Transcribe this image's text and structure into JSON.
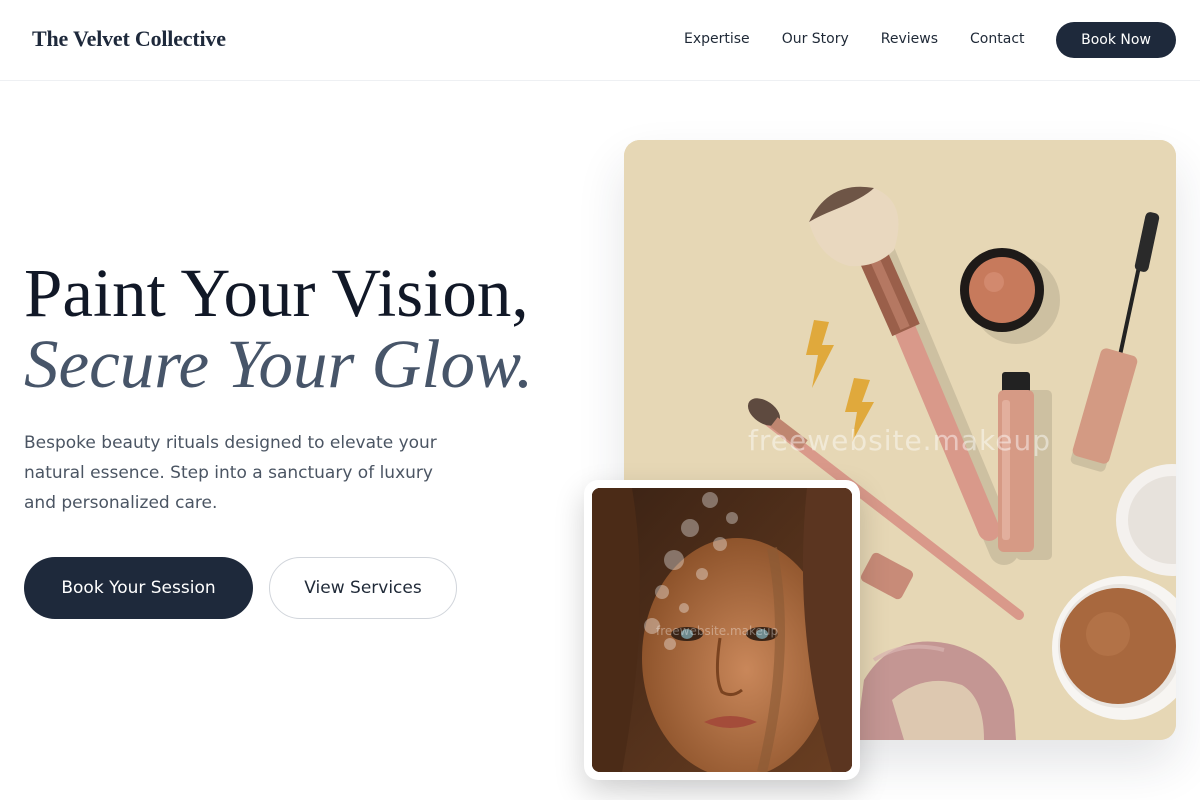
{
  "header": {
    "brand": "The Velvet Collective",
    "nav": [
      "Expertise",
      "Our Story",
      "Reviews",
      "Contact"
    ],
    "cta_label": "Book Now"
  },
  "hero": {
    "headline_line1": "Paint Your Vision,",
    "headline_line2": "Secure Your Glow.",
    "description": "Bespoke beauty rituals designed to elevate your natural essence. Step into a sanctuary of luxury and personalized care.",
    "primary_button": "Book Your Session",
    "secondary_button": "View Services"
  },
  "images": {
    "main_watermark": "freewebsite.makeup",
    "portrait_watermark": "freewebsite.makeup"
  },
  "colors": {
    "primary": "#1e293b",
    "accent_text": "#475569",
    "image_background": "#e6d7b5"
  }
}
